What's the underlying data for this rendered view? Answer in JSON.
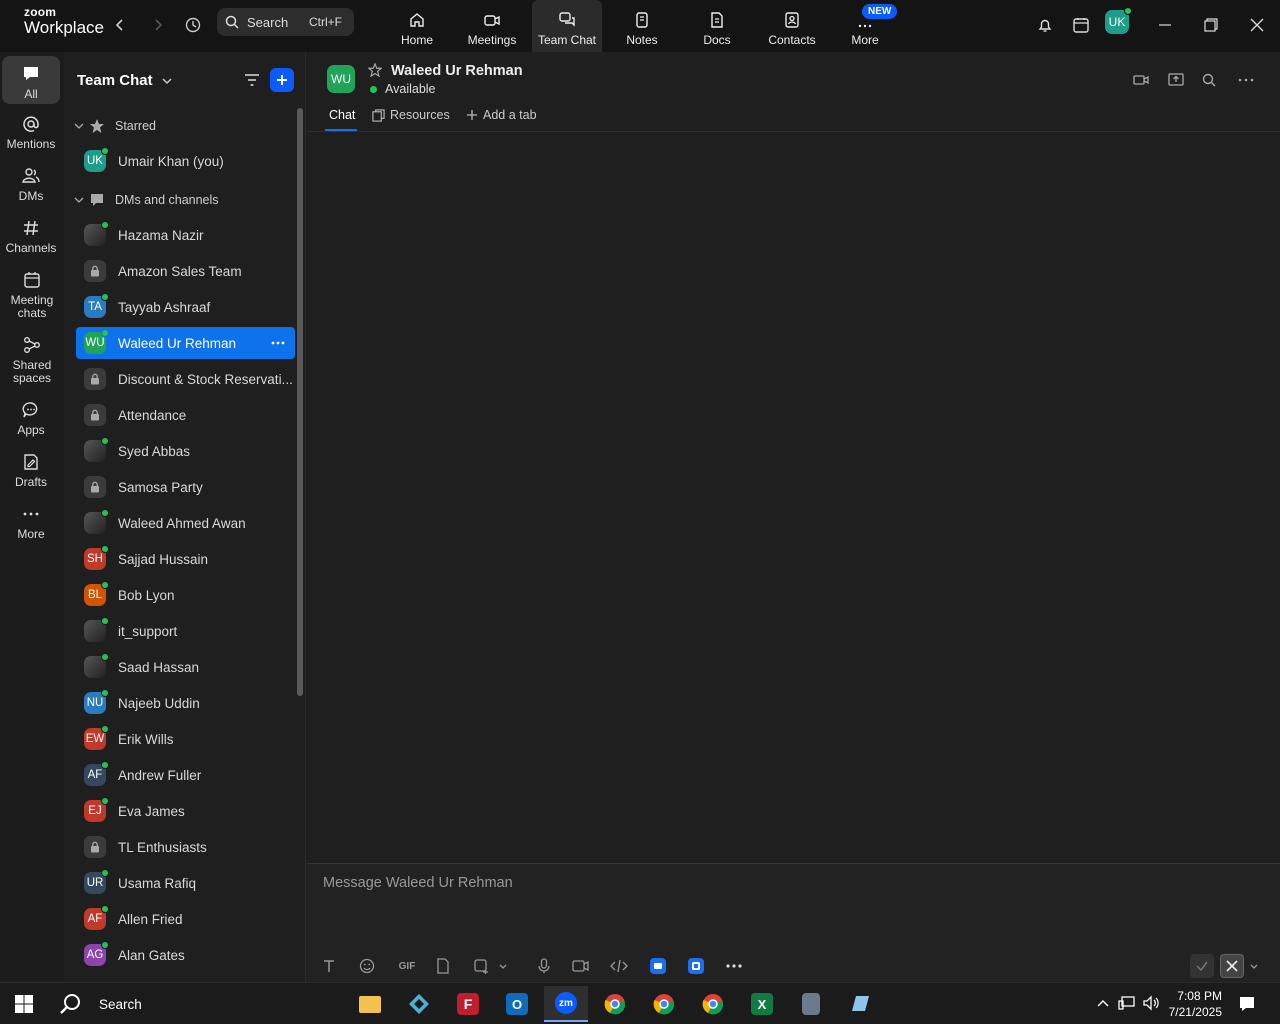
{
  "app": {
    "logo_line1": "zoom",
    "logo_line2": "Workplace"
  },
  "top": {
    "search_placeholder": "Search",
    "search_shortcut": "Ctrl+F",
    "tabs": [
      {
        "label": "Home",
        "icon": "home-icon"
      },
      {
        "label": "Meetings",
        "icon": "video-camera-icon"
      },
      {
        "label": "Team Chat",
        "icon": "chat-bubbles-icon"
      },
      {
        "label": "Notes",
        "icon": "notes-icon"
      },
      {
        "label": "Docs",
        "icon": "document-icon"
      },
      {
        "label": "Contacts",
        "icon": "contact-card-icon"
      },
      {
        "label": "More",
        "icon": "ellipsis-icon"
      }
    ],
    "new_badge": "NEW",
    "user_initials": "UK"
  },
  "rail": [
    {
      "label": "All"
    },
    {
      "label": "Mentions"
    },
    {
      "label": "DMs"
    },
    {
      "label": "Channels"
    },
    {
      "label": "Meeting chats"
    },
    {
      "label": "Shared spaces"
    },
    {
      "label": "Apps"
    },
    {
      "label": "Drafts"
    },
    {
      "label": "More"
    }
  ],
  "sidebar": {
    "title": "Team Chat",
    "sections": {
      "starred": "Starred",
      "dms": "DMs and channels"
    },
    "starred": [
      {
        "label": "Umair Khan (you)",
        "initials": "UK",
        "color": "#1f9d8b"
      }
    ],
    "items": [
      {
        "label": "Hazama Nazir",
        "type": "photo"
      },
      {
        "label": "Amazon Sales Team",
        "type": "lock"
      },
      {
        "label": "Tayyab Ashraaf",
        "initials": "TA",
        "color": "#2a7bbf"
      },
      {
        "label": "Waleed Ur Rehman",
        "initials": "WU",
        "color": "#22a35a",
        "selected": true
      },
      {
        "label": "Discount & Stock Reservati...",
        "type": "lock"
      },
      {
        "label": "Attendance",
        "type": "lock"
      },
      {
        "label": "Syed Abbas",
        "type": "photo"
      },
      {
        "label": "Samosa Party",
        "type": "lock"
      },
      {
        "label": "Waleed Ahmed Awan",
        "type": "photo"
      },
      {
        "label": "Sajjad Hussain",
        "initials": "SH",
        "color": "#c0392b"
      },
      {
        "label": "Bob Lyon",
        "initials": "BL",
        "color": "#d35400"
      },
      {
        "label": "it_support",
        "type": "photo"
      },
      {
        "label": "Saad Hassan",
        "type": "photo"
      },
      {
        "label": "Najeeb Uddin",
        "initials": "NU",
        "color": "#2a7bbf"
      },
      {
        "label": "Erik Wills",
        "initials": "EW",
        "color": "#c0392b"
      },
      {
        "label": "Andrew Fuller",
        "initials": "AF",
        "color": "#34495e"
      },
      {
        "label": "Eva James",
        "initials": "EJ",
        "color": "#c0392b"
      },
      {
        "label": "TL Enthusiasts",
        "type": "lock"
      },
      {
        "label": "Usama Rafiq",
        "initials": "UR",
        "color": "#34495e"
      },
      {
        "label": "Allen Fried",
        "initials": "AF",
        "color": "#c0392b"
      },
      {
        "label": "Alan Gates",
        "initials": "AG",
        "color": "#8e44ad"
      }
    ]
  },
  "chat": {
    "avatar": "WU",
    "name": "Waleed Ur Rehman",
    "status": "Available",
    "tabs": {
      "chat": "Chat",
      "resources": "Resources",
      "add": "Add a tab"
    },
    "composer_placeholder": "Message Waleed Ur Rehman",
    "gif": "GIF"
  },
  "taskbar": {
    "search": "Search",
    "time": "7:08 PM",
    "date": "7/21/2025"
  }
}
